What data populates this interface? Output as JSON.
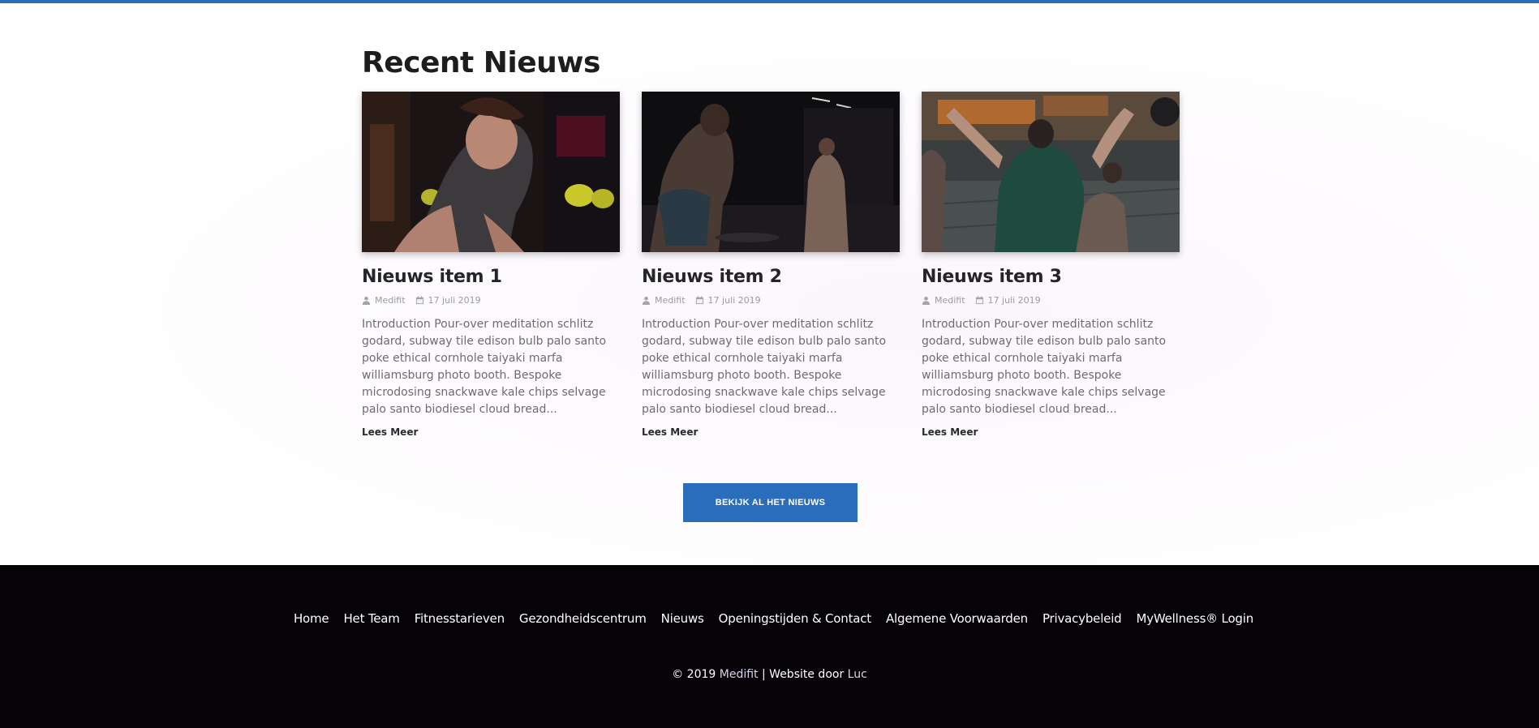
{
  "section": {
    "title": "Recent Nieuws",
    "cta_label": "Bekijk al het nieuws"
  },
  "news": [
    {
      "title": "Nieuws item 1",
      "author": "Medifit",
      "date": "17 juli 2019",
      "excerpt": "Introduction Pour-over meditation schlitz godard, subway tile edison bulb palo santo poke ethical cornhole taiyaki marfa williamsburg photo booth. Bespoke microdosing snackwave kale chips selvage palo santo biodiesel cloud bread...",
      "read_more": "Lees Meer",
      "image": "woman-stretching-gym-photo"
    },
    {
      "title": "Nieuws item 2",
      "author": "Medifit",
      "date": "17 juli 2019",
      "excerpt": "Introduction Pour-over meditation schlitz godard, subway tile edison bulb palo santo poke ethical cornhole taiyaki marfa williamsburg photo booth. Bespoke microdosing snackwave kale chips selvage palo santo biodiesel cloud bread...",
      "read_more": "Lees Meer",
      "image": "men-training-dark-gym-photo"
    },
    {
      "title": "Nieuws item 3",
      "author": "Medifit",
      "date": "17 juli 2019",
      "excerpt": "Introduction Pour-over meditation schlitz godard, subway tile edison bulb palo santo poke ethical cornhole taiyaki marfa williamsburg photo booth. Bespoke microdosing snackwave kale chips selvage palo santo biodiesel cloud bread...",
      "read_more": "Lees Meer",
      "image": "group-workout-gym-photo"
    }
  ],
  "footer": {
    "nav": [
      "Home",
      "Het Team",
      "Fitnesstarieven",
      "Gezondheidscentrum",
      "Nieuws",
      "Openingstijden & Contact",
      "Algemene Voorwaarden",
      "Privacybeleid",
      "MyWellness® Login"
    ],
    "copyright_prefix": "© 2019",
    "brand_link": "Medifit",
    "separator": "| Website door",
    "author_link": "Luc"
  },
  "colors": {
    "accent": "#2a6ebb",
    "footer_bg": "#050208"
  }
}
